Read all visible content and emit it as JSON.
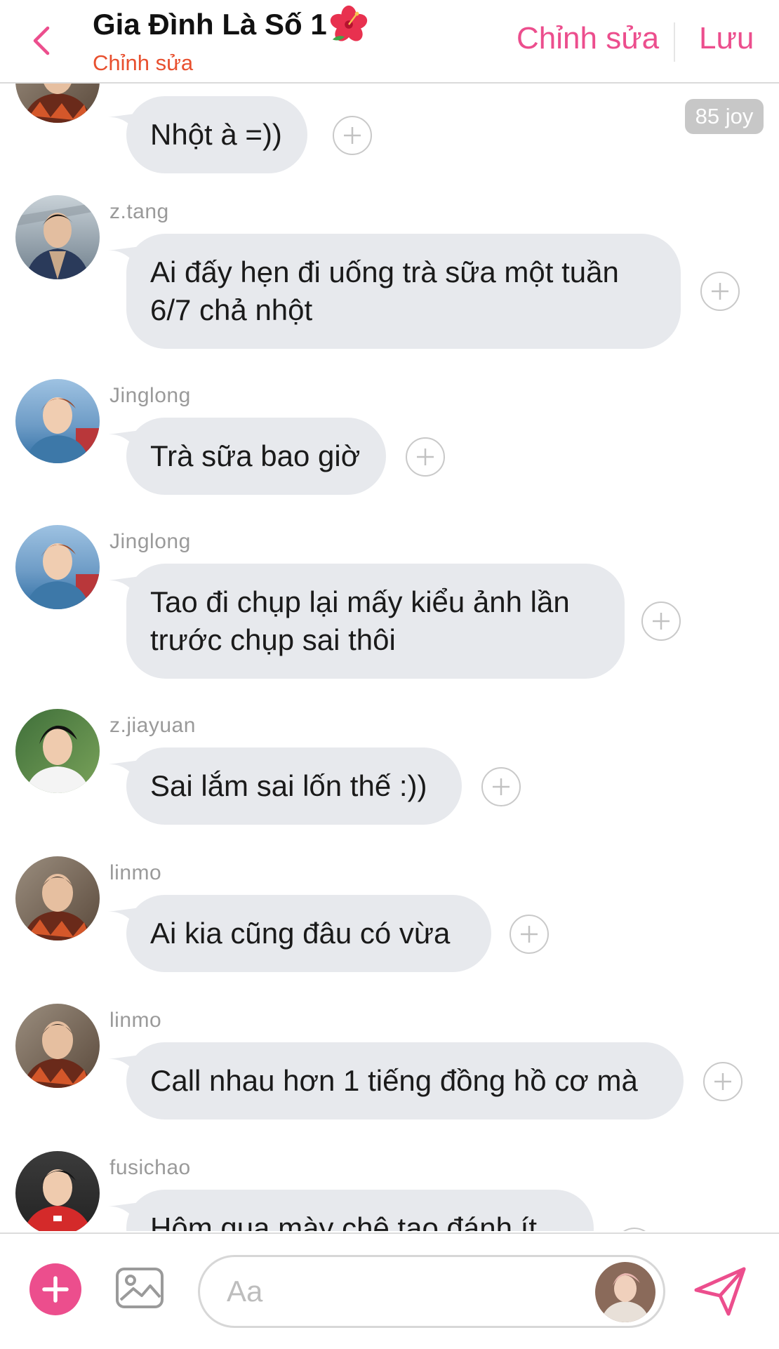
{
  "header": {
    "title": "Gia Đình Là Số 1",
    "subtitle": "Chỉnh sửa",
    "edit_label": "Chỉnh sửa",
    "save_label": "Lưu",
    "back_icon": "chevron-left-icon",
    "title_emoji": "hibiscus-icon"
  },
  "colors": {
    "accent": "#ec4e8d",
    "subtitle": "#e8502f",
    "bubble": "#e7e9ed",
    "username": "#9a9a9a"
  },
  "messages": [
    {
      "user": "",
      "text": "Nhột à =))",
      "badge": "85 joy"
    },
    {
      "user": "z.tang",
      "text": "Ai đấy hẹn đi uống trà sữa một tuần 6/7 chả nhột"
    },
    {
      "user": "Jinglong",
      "text": "Trà sữa bao giờ"
    },
    {
      "user": "Jinglong",
      "text": "Tao đi chụp lại mấy kiểu ảnh lần trước chụp sai thôi"
    },
    {
      "user": "z.jiayuan",
      "text": "Sai lắm sai lốn thế :))"
    },
    {
      "user": "linmo",
      "text": "Ai kia cũng đâu có vừa"
    },
    {
      "user": "linmo",
      "text": "Call nhau hơn 1 tiếng đồng hồ cơ mà"
    },
    {
      "user": "fusichao",
      "text": "Hôm qua mày chê tao đánh ít"
    }
  ],
  "composer": {
    "placeholder": "Aa",
    "add_icon": "plus-icon",
    "image_icon": "image-icon",
    "send_icon": "send-icon"
  }
}
